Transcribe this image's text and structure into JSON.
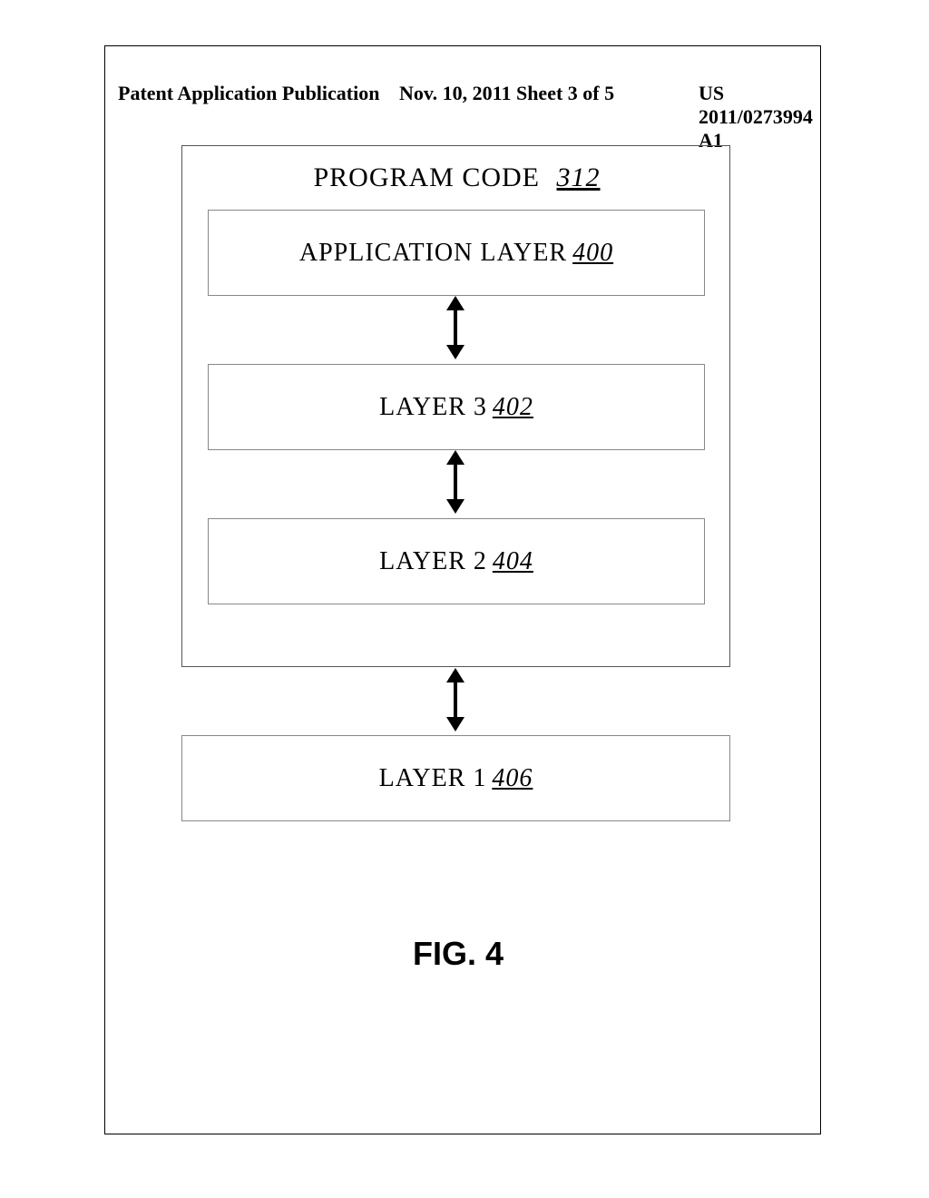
{
  "header": {
    "left": "Patent Application Publication",
    "mid": "Nov. 10, 2011  Sheet 3 of 5",
    "right": "US 2011/0273994 A1"
  },
  "diagram": {
    "outer_label": "PROGRAM CODE",
    "outer_ref": "312",
    "layers": {
      "app": {
        "label": "APPLICATION LAYER",
        "ref": "400"
      },
      "l3": {
        "label": "LAYER 3",
        "ref": "402"
      },
      "l2": {
        "label": "LAYER 2",
        "ref": "404"
      },
      "l1": {
        "label": "LAYER 1",
        "ref": "406"
      }
    }
  },
  "figure_label": "FIG. 4"
}
